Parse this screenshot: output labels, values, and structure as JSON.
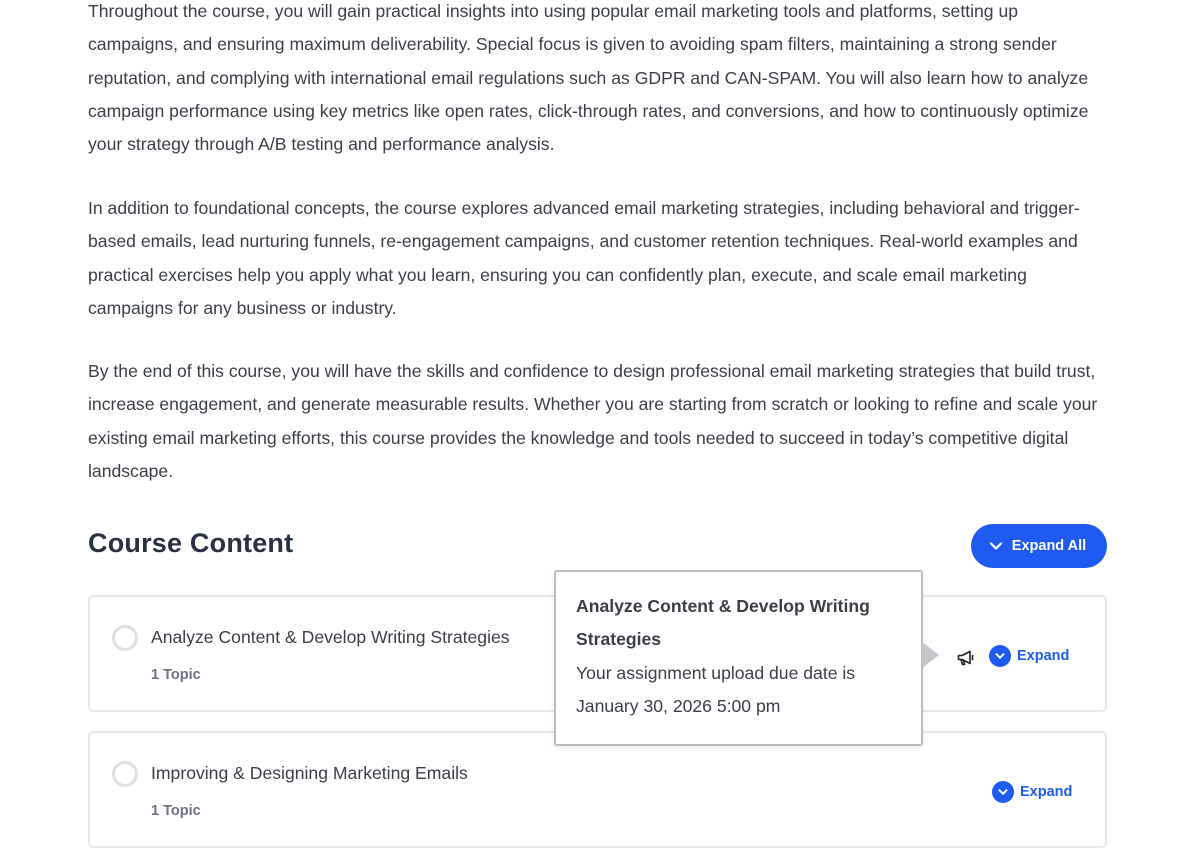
{
  "description": {
    "paragraphs": [
      "Throughout the course, you will gain practical insights into using popular email marketing tools and platforms, setting up campaigns, and ensuring maximum deliverability. Special focus is given to avoiding spam filters, maintaining a strong sender reputation, and complying with international email regulations such as GDPR and CAN-SPAM. You will also learn how to analyze campaign performance using key metrics like open rates, click-through rates, and conversions, and how to continuously optimize your strategy through A/B testing and performance analysis.",
      "In addition to foundational concepts, the course explores advanced email marketing strategies, including behavioral and trigger-based emails, lead nurturing funnels, re-engagement campaigns, and customer retention techniques. Real-world examples and practical exercises help you apply what you learn, ensuring you can confidently plan, execute, and scale email marketing campaigns for any business or industry.",
      "By the end of this course, you will have the skills and confidence to design professional email marketing strategies that build trust, increase engagement, and generate measurable results. Whether you are starting from scratch or looking to refine and scale your existing email marketing efforts, this course provides the knowledge and tools needed to succeed in today’s competitive digital landscape."
    ]
  },
  "course_content": {
    "title": "Course Content",
    "expand_all_label": "Expand All",
    "lessons": [
      {
        "title": "Analyze Content & Develop Writing Strategies",
        "topic_count": "1 Topic",
        "expand_label": "Expand",
        "icon": "megaphone-icon"
      },
      {
        "title": "Improving & Designing Marketing Emails",
        "topic_count": "1 Topic",
        "expand_label": "Expand"
      }
    ]
  },
  "tooltip": {
    "title": "Analyze Content & Develop Writing Strategies",
    "line1": "Your assignment upload due date is",
    "line2": "January 30, 2026 5:00 pm"
  },
  "colors": {
    "accent": "#1f5bf0",
    "text": "#3a3f47",
    "heading": "#27313f",
    "muted": "#6b7280",
    "border": "#e6e8ec"
  }
}
